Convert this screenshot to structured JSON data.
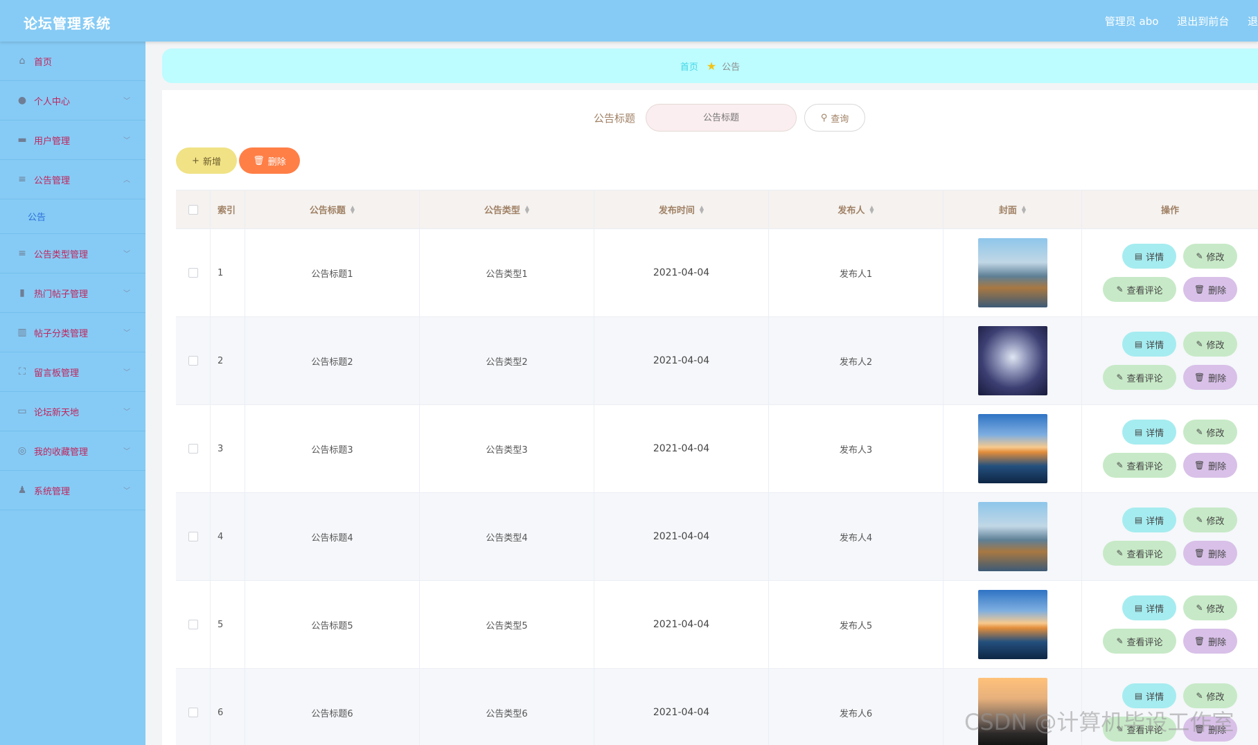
{
  "header": {
    "brand": "论坛管理系统",
    "admin_label": "管理员 abo",
    "front_link": "退出到前台",
    "logout_link": "退"
  },
  "sidebar": {
    "items": [
      {
        "label": "首页",
        "icon": "home-icon"
      },
      {
        "label": "个人中心",
        "icon": "user-icon"
      },
      {
        "label": "用户管理",
        "icon": "users-icon"
      },
      {
        "label": "公告管理",
        "icon": "list-icon",
        "expanded": true
      },
      {
        "label": "公告",
        "sub": true,
        "active": true
      },
      {
        "label": "公告类型管理",
        "icon": "list-icon"
      },
      {
        "label": "热门帖子管理",
        "icon": "bar-chart-icon"
      },
      {
        "label": "帖子分类管理",
        "icon": "book-icon"
      },
      {
        "label": "留言板管理",
        "icon": "frame-icon"
      },
      {
        "label": "论坛新天地",
        "icon": "board-icon"
      },
      {
        "label": "我的收藏管理",
        "icon": "star-circle-icon"
      },
      {
        "label": "系统管理",
        "icon": "person-icon"
      }
    ]
  },
  "breadcrumb": {
    "home": "首页",
    "current": "公告"
  },
  "search": {
    "label": "公告标题",
    "placeholder": "公告标题",
    "button": "查询"
  },
  "toolbar": {
    "add": "新增",
    "delete": "删除"
  },
  "table": {
    "columns": {
      "index": "索引",
      "title": "公告标题",
      "type": "公告类型",
      "time": "发布时间",
      "author": "发布人",
      "cover": "封面",
      "ops": "操作"
    },
    "rows": [
      {
        "index": "1",
        "title": "公告标题1",
        "type": "公告类型1",
        "time": "2021-04-04",
        "author": "发布人1",
        "cover": "t1"
      },
      {
        "index": "2",
        "title": "公告标题2",
        "type": "公告类型2",
        "time": "2021-04-04",
        "author": "发布人2",
        "cover": "t2"
      },
      {
        "index": "3",
        "title": "公告标题3",
        "type": "公告类型3",
        "time": "2021-04-04",
        "author": "发布人3",
        "cover": "t3"
      },
      {
        "index": "4",
        "title": "公告标题4",
        "type": "公告类型4",
        "time": "2021-04-04",
        "author": "发布人4",
        "cover": "t1"
      },
      {
        "index": "5",
        "title": "公告标题5",
        "type": "公告类型5",
        "time": "2021-04-04",
        "author": "发布人5",
        "cover": "t3"
      },
      {
        "index": "6",
        "title": "公告标题6",
        "type": "公告类型6",
        "time": "2021-04-04",
        "author": "发布人6",
        "cover": "t4"
      }
    ],
    "row_actions": {
      "detail": "详情",
      "edit": "修改",
      "comments": "查看评论",
      "delete": "删除"
    }
  },
  "watermark": "CSDN @计算机毕设工作室",
  "colors": {
    "header_bg": "#86cbf5",
    "breadcrumb_bg": "#bdfcff",
    "add_button": "#f0e285",
    "delete_button": "#ff7f47",
    "detail_button": "#a5ecf0",
    "edit_button": "#c7e9c7",
    "remove_button": "#d8c0e8"
  }
}
